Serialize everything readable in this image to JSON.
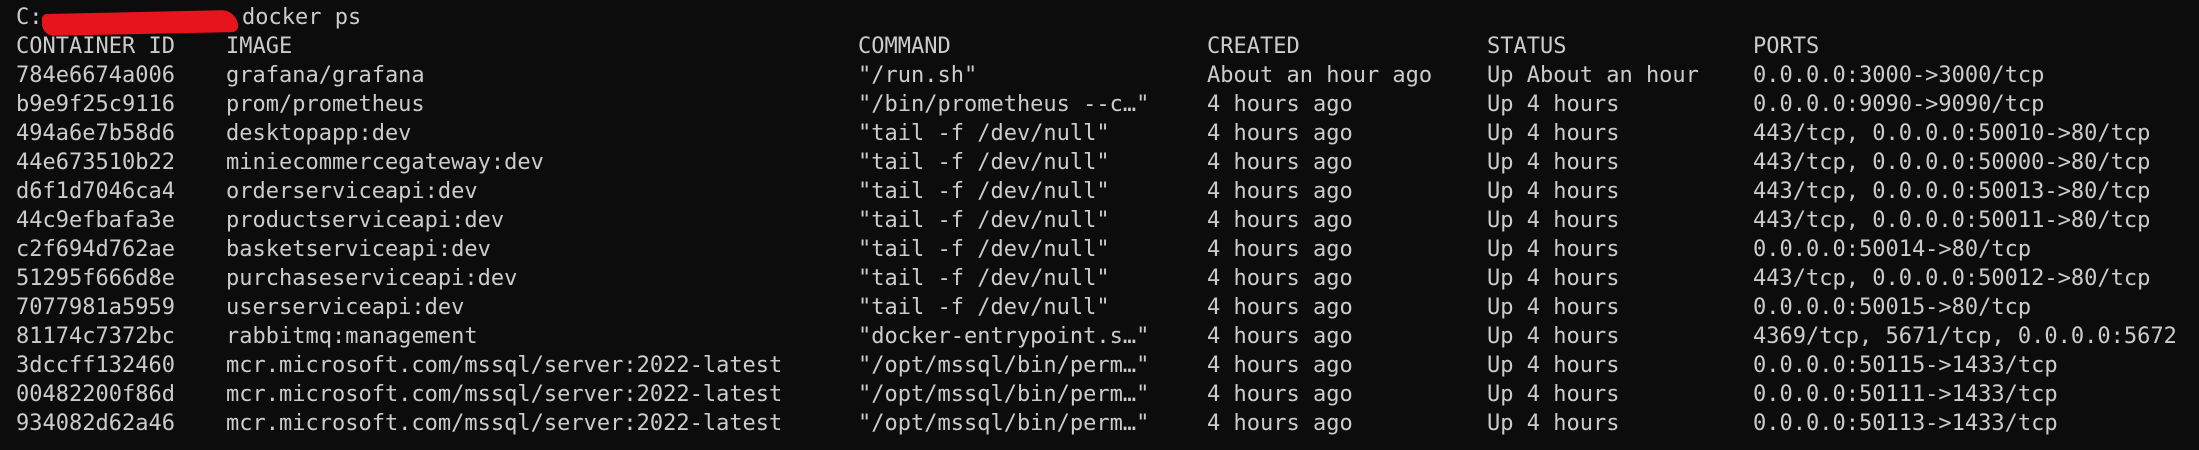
{
  "terminal": {
    "prompt_prefix": "C:",
    "command": "docker ps",
    "headers": [
      "CONTAINER ID",
      "IMAGE",
      "COMMAND",
      "CREATED",
      "STATUS",
      "PORTS"
    ],
    "rows": [
      [
        "784e6674a006",
        "grafana/grafana",
        "\"/run.sh\"",
        "About an hour ago",
        "Up About an hour",
        "0.0.0.0:3000->3000/tcp"
      ],
      [
        "b9e9f25c9116",
        "prom/prometheus",
        "\"/bin/prometheus --c…\"",
        "4 hours ago",
        "Up 4 hours",
        "0.0.0.0:9090->9090/tcp"
      ],
      [
        "494a6e7b58d6",
        "desktopapp:dev",
        "\"tail -f /dev/null\"",
        "4 hours ago",
        "Up 4 hours",
        "443/tcp, 0.0.0.0:50010->80/tcp"
      ],
      [
        "44e673510b22",
        "miniecommercegateway:dev",
        "\"tail -f /dev/null\"",
        "4 hours ago",
        "Up 4 hours",
        "443/tcp, 0.0.0.0:50000->80/tcp"
      ],
      [
        "d6f1d7046ca4",
        "orderserviceapi:dev",
        "\"tail -f /dev/null\"",
        "4 hours ago",
        "Up 4 hours",
        "443/tcp, 0.0.0.0:50013->80/tcp"
      ],
      [
        "44c9efbafa3e",
        "productserviceapi:dev",
        "\"tail -f /dev/null\"",
        "4 hours ago",
        "Up 4 hours",
        "443/tcp, 0.0.0.0:50011->80/tcp"
      ],
      [
        "c2f694d762ae",
        "basketserviceapi:dev",
        "\"tail -f /dev/null\"",
        "4 hours ago",
        "Up 4 hours",
        "0.0.0.0:50014->80/tcp"
      ],
      [
        "51295f666d8e",
        "purchaseserviceapi:dev",
        "\"tail -f /dev/null\"",
        "4 hours ago",
        "Up 4 hours",
        "443/tcp, 0.0.0.0:50012->80/tcp"
      ],
      [
        "7077981a5959",
        "userserviceapi:dev",
        "\"tail -f /dev/null\"",
        "4 hours ago",
        "Up 4 hours",
        "0.0.0.0:50015->80/tcp"
      ],
      [
        "81174c7372bc",
        "rabbitmq:management",
        "\"docker-entrypoint.s…\"",
        "4 hours ago",
        "Up 4 hours",
        "4369/tcp, 5671/tcp, 0.0.0.0:5672"
      ],
      [
        "3dccff132460",
        "mcr.microsoft.com/mssql/server:2022-latest",
        "\"/opt/mssql/bin/perm…\"",
        "4 hours ago",
        "Up 4 hours",
        "0.0.0.0:50115->1433/tcp"
      ],
      [
        "00482200f86d",
        "mcr.microsoft.com/mssql/server:2022-latest",
        "\"/opt/mssql/bin/perm…\"",
        "4 hours ago",
        "Up 4 hours",
        "0.0.0.0:50111->1433/tcp"
      ],
      [
        "934082d62a46",
        "mcr.microsoft.com/mssql/server:2022-latest",
        "\"/opt/mssql/bin/perm…\"",
        "4 hours ago",
        "Up 4 hours",
        "0.0.0.0:50113->1433/tcp"
      ]
    ]
  }
}
